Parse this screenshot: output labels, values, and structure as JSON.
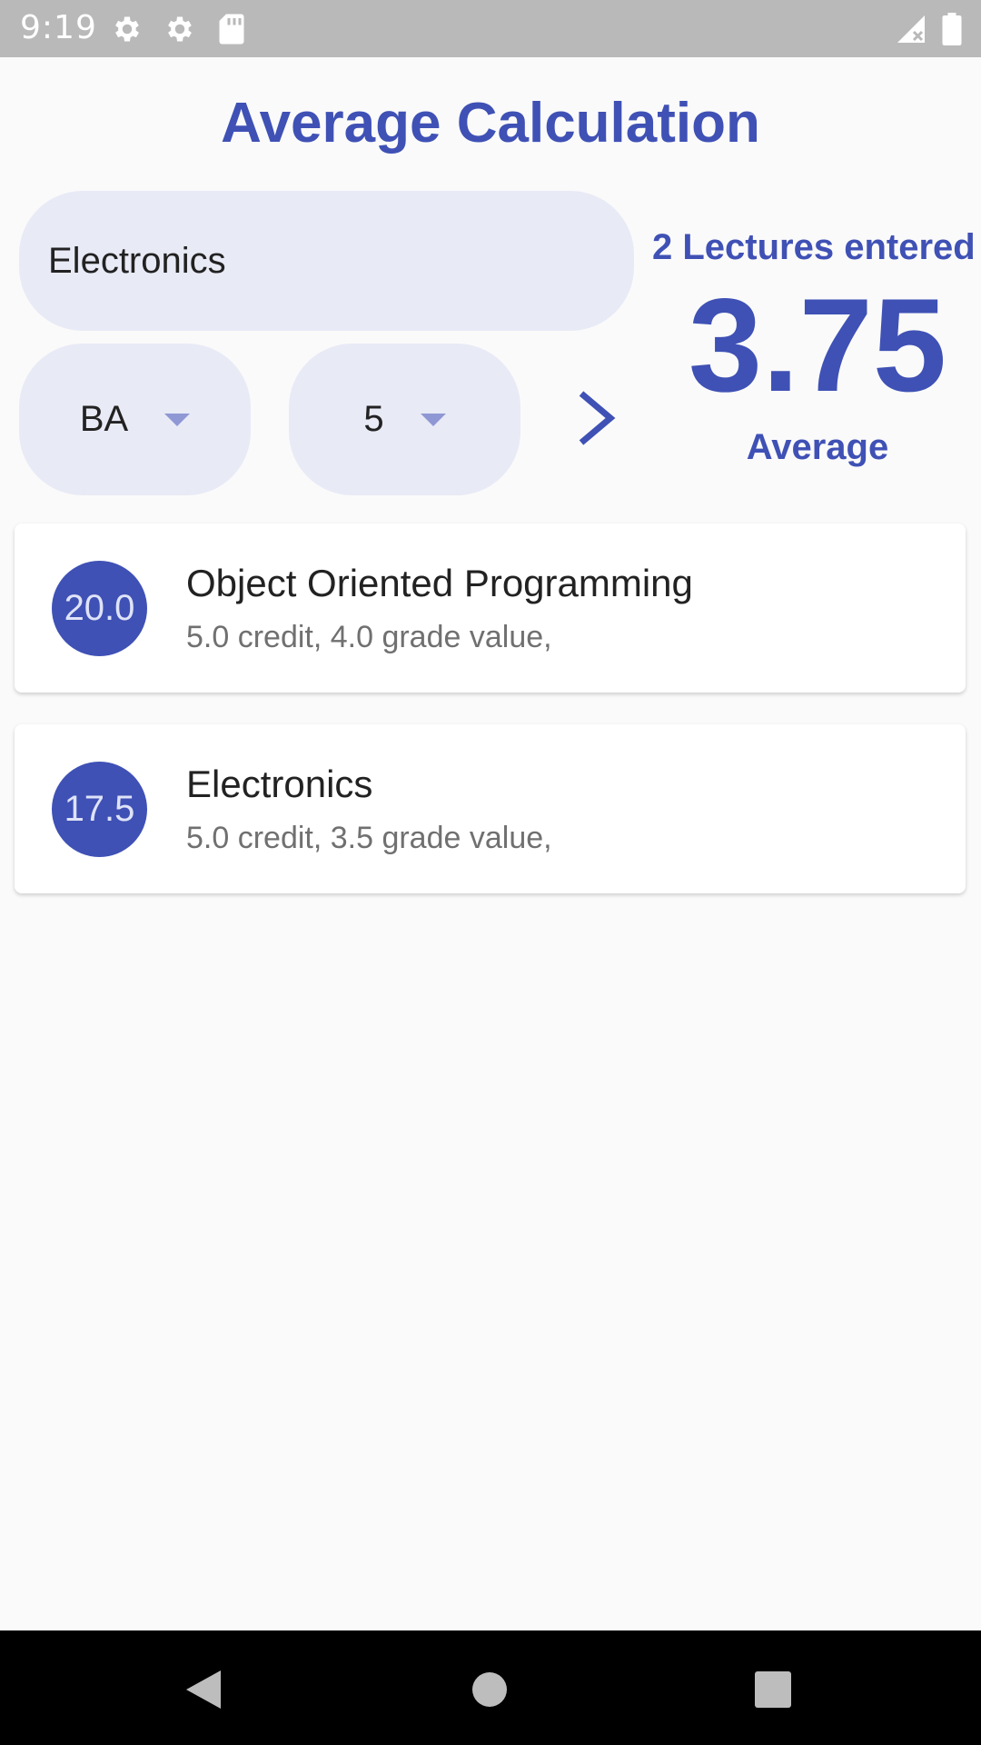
{
  "status_bar": {
    "time": "9:19",
    "icons": [
      "gear-icon",
      "gear-icon",
      "sd-card-icon",
      "signal-icon",
      "battery-icon"
    ]
  },
  "app": {
    "title": "Average Calculation",
    "accent_color": "#3f51b5",
    "field_color": "#e8eaf6"
  },
  "form": {
    "lecture_name": "Electronics",
    "grade_selected": "BA",
    "credit_selected": "5"
  },
  "summary": {
    "lectures_entered": "2 Lectures entered",
    "average_value": "3.75",
    "average_label": "Average"
  },
  "lectures": [
    {
      "badge": "20.0",
      "name": "Object Oriented Programming",
      "details": "5.0 credit, 4.0 grade value,"
    },
    {
      "badge": "17.5",
      "name": "Electronics",
      "details": "5.0 credit, 3.5 grade value,"
    }
  ],
  "nav": {
    "icons": [
      "back-icon",
      "home-icon",
      "recents-icon"
    ]
  }
}
